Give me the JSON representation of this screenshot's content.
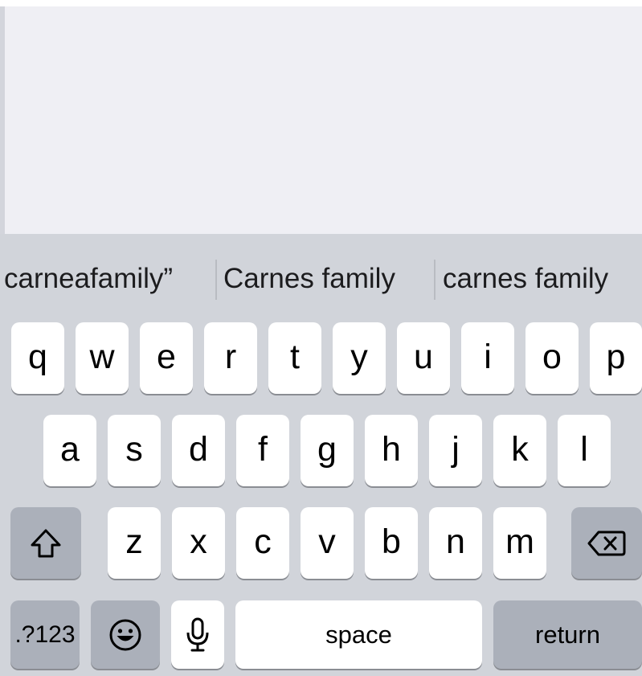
{
  "suggestions": [
    {
      "text": "carneafamily”"
    },
    {
      "text": "Carnes family"
    },
    {
      "text": "carnes family"
    }
  ],
  "keyboard": {
    "row1": [
      "q",
      "w",
      "e",
      "r",
      "t",
      "y",
      "u",
      "i",
      "o",
      "p"
    ],
    "row2": [
      "a",
      "s",
      "d",
      "f",
      "g",
      "h",
      "j",
      "k",
      "l"
    ],
    "row3": [
      "z",
      "x",
      "c",
      "v",
      "b",
      "n",
      "m"
    ],
    "icons": {
      "shift": "shift-icon",
      "delete": "backspace-icon",
      "emoji": "emoji-icon",
      "dictation": "microphone-icon"
    },
    "numbers_label": ".?123",
    "space_label": "space",
    "return_label": "return"
  },
  "colors": {
    "keyboard_background": "#d1d4da",
    "key_background": "#ffffff",
    "special_key_background": "#abb0ba",
    "content_background": "#efeff4"
  }
}
